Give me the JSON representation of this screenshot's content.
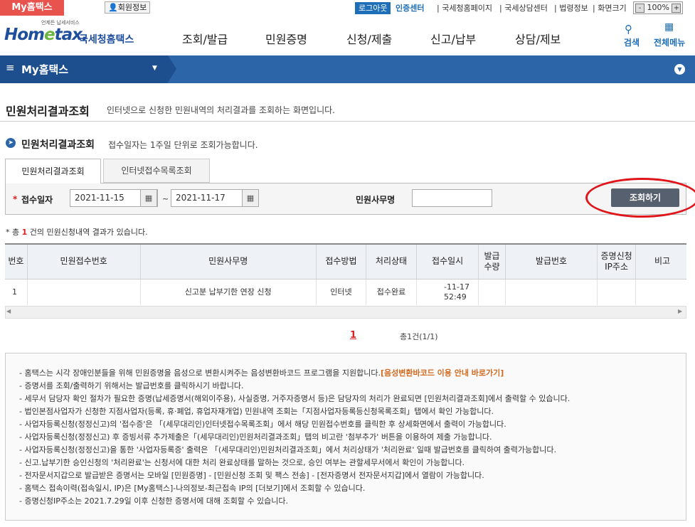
{
  "topbar": {
    "myhome_tab": "My홈택스",
    "member_info": "회원정보",
    "logout": "로그아웃",
    "cert_center": "인증센터",
    "util_links": [
      "국세청홈페이지",
      "국세상담센터",
      "법령정보",
      "화면크기"
    ],
    "zoom_minus": "-",
    "zoom_value": "100%",
    "zoom_plus": "+"
  },
  "header": {
    "logo_sub": "언제든 납세서비스",
    "logo_main_a": "Hom",
    "logo_main_e": "e",
    "logo_main_b": "tax.",
    "logo_kr": "국세청홈택스",
    "nav": [
      "조회/발급",
      "민원증명",
      "신청/제출",
      "신고/납부",
      "상담/제보"
    ],
    "search_label": "검색",
    "allmenu_label": "전체메뉴"
  },
  "bluebar": {
    "menu_title": "My홈택스"
  },
  "page": {
    "title": "민원처리결과조회",
    "desc": "인터넷으로 신청한 민원내역의 처리결과를 조회하는 화면입니다."
  },
  "section": {
    "title": "민원처리결과조회",
    "desc": "접수일자는 1주일 단위로 조회가능합니다."
  },
  "tabs": [
    "민원처리결과조회",
    "인터넷접수목록조회"
  ],
  "search": {
    "required_mark": "*",
    "date_label": "접수일자",
    "date_from": "2021-11-15",
    "tilde": "~",
    "date_to": "2021-11-17",
    "office_label": "민원사무명",
    "office_value": "",
    "query_button": "조회하기"
  },
  "result": {
    "prefix": "* 총 ",
    "count": "1",
    "suffix": " 건의 민원신청내역 결과가 있습니다."
  },
  "grid": {
    "headers": [
      "번호",
      "민원접수번호",
      "민원사무명",
      "접수방법",
      "처리상태",
      "접수일시",
      "발급\n수량",
      "발급번호",
      "증명신청\nIP주소",
      "비고"
    ],
    "rows": [
      {
        "no": "1",
        "receipt_no": "",
        "office": "신고분 납부기한 연장 신청",
        "method": "인터넷",
        "status": "접수완료",
        "datetime_1": "-11-17",
        "datetime_2": "52:49",
        "qty": "",
        "issue_no": "",
        "ip": "",
        "note": ""
      }
    ]
  },
  "pagination": {
    "current": "1",
    "total": "총1건(1/1)"
  },
  "notice": [
    {
      "text": "- 홈택스는 시각 장애인분들을 위해 민원증명을 음성으로 변환시켜주는 음성변환바코드 프로그램을 지원합니다.",
      "link": "[음성변환바코드 이용 안내 바로가기]"
    },
    {
      "text": "- 증명서를 조회/출력하기 위해서는 발급번호를 클릭하시기 바랍니다."
    },
    {
      "text": "- 세무서 담당자 확인 절차가 필요한 증명(납세증명서(해외이주용), 사실증명, 거주자증명서 등)은 담당자의 처리가 완료되면 [민원처리결과조회]에서 출력할 수 있습니다."
    },
    {
      "text": "- 법인본점사업자가 신청한 지점사업자(등록, 휴·폐업, 휴업자재개업) 민원내역 조회는「지점사업자등록등신청목록조회」탭에서 확인 가능합니다."
    },
    {
      "text": "- 사업자등록신청(정정신고)의 '접수증'은 「(세무대리인)인터넷접수목록조회」에서 해당 민원접수번호를 클릭한 후 상세화면에서 출력이 가능합니다."
    },
    {
      "text": "- 사업자등록신청(정정신고) 후 증빙서류 추가제출은「(세무대리인)민원처리결과조회」탭의 비고란 '첨부추가' 버튼을 이용하여 제출 가능합니다."
    },
    {
      "text": "- 사업자등록신청(정정신고)을 통한 '사업자등록증' 출력은 「(세무대리인)민원처리결과조회」에서 처리상태가 '처리완료' 일때 발급번호를 클릭하여 출력가능합니다."
    },
    {
      "text": "- 신고.납부기한 승인신청의 '처리완료'는 신청서에 대한 처리 완료상태를 말하는 것으로, 승인 여부는 관할세무서에서 확인이 가능합니다."
    },
    {
      "text": "- 전자문서지갑으로 발급받은 증명서는 모바일 [민원증명] - [민원신청 조회 및 팩스 전송] - [전자증명서 전자문서지갑]에서 열람이 가능합니다."
    },
    {
      "text": "- 홈택스 접속이력(접속일시, IP)은 [My홈택스]-나의정보-최근접속 IP의 [더보기]에서 조회할 수 있습니다."
    },
    {
      "text": "- 증명신청IP주소는 2021.7.29일 이후 신청한 증명서에 대해 조회할 수 있습니다."
    }
  ]
}
